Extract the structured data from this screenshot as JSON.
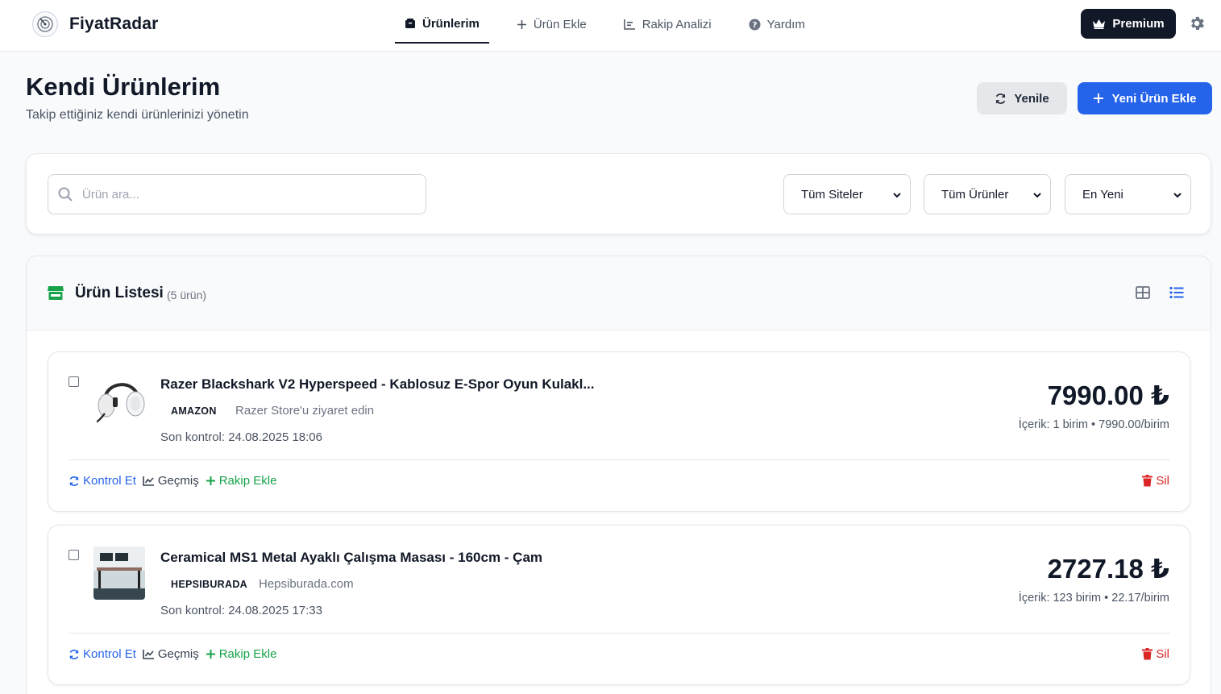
{
  "brand": {
    "name": "FiyatRadar"
  },
  "nav": [
    {
      "label": "Ürünlerim",
      "active": true
    },
    {
      "label": "Ürün Ekle",
      "active": false
    },
    {
      "label": "Rakip Analizi",
      "active": false
    },
    {
      "label": "Yardım",
      "active": false
    }
  ],
  "premium": {
    "label": "Premium"
  },
  "header": {
    "title": "Kendi Ürünlerim",
    "subtitle": "Takip ettiğiniz kendi ürünlerinizi yönetin",
    "refresh_label": "Yenile",
    "add_label": "Yeni Ürün Ekle"
  },
  "filters": {
    "search_placeholder": "Ürün ara...",
    "site_select": "Tüm Siteler",
    "product_select": "Tüm Ürünler",
    "sort_select": "En Yeni"
  },
  "list": {
    "title": "Ürün Listesi",
    "count": "(5 ürün)"
  },
  "actions": {
    "check": "Kontrol Et",
    "history": "Geçmiş",
    "add_rival": "Rakip Ekle",
    "delete": "Sil"
  },
  "products": [
    {
      "name": "Razer Blackshark V2 Hyperspeed - Kablosuz E-Spor Oyun Kulakl...",
      "site": "AMAZON",
      "store": "Razer Store'u ziyaret edin",
      "last_check": "Son kontrol: 24.08.2025 18:06",
      "price": "7990.00 ₺",
      "unit_info": "İçerik: 1 birim • 7990.00/birim"
    },
    {
      "name": "Ceramical MS1 Metal Ayaklı Çalışma Masası - 160cm - Çam",
      "site": "HEPSIBURADA",
      "store": "Hepsiburada.com",
      "last_check": "Son kontrol: 24.08.2025 17:33",
      "price": "2727.18 ₺",
      "unit_info": "İçerik: 123 birim • 22.17/birim"
    }
  ],
  "colors": {
    "primary": "#2563eb",
    "dark": "#111827",
    "success": "#16a34a",
    "danger": "#dc2626"
  }
}
